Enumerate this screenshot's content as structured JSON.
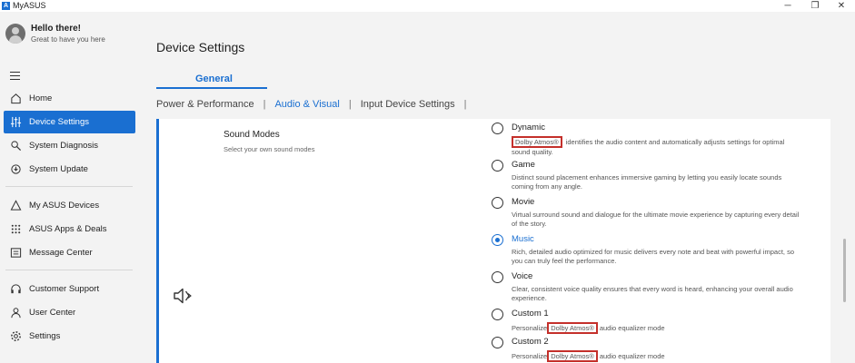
{
  "window": {
    "title": "MyASUS",
    "minimize": "─",
    "maximize": "❐",
    "close": "✕"
  },
  "user": {
    "greeting": "Hello there!",
    "subtitle": "Great to have you here"
  },
  "sidebar": {
    "items": [
      {
        "label": "Home",
        "icon": "home-icon"
      },
      {
        "label": "Device Settings",
        "icon": "sliders-icon",
        "active": true
      },
      {
        "label": "System Diagnosis",
        "icon": "diagnosis-icon"
      },
      {
        "label": "System Update",
        "icon": "update-icon"
      },
      {
        "label": "My ASUS Devices",
        "icon": "devices-icon"
      },
      {
        "label": "ASUS Apps & Deals",
        "icon": "apps-grid-icon"
      },
      {
        "label": "Message Center",
        "icon": "message-icon"
      },
      {
        "label": "Customer Support",
        "icon": "headset-icon"
      },
      {
        "label": "User Center",
        "icon": "user-icon"
      },
      {
        "label": "Settings",
        "icon": "gear-icon"
      }
    ]
  },
  "main": {
    "title": "Device Settings",
    "tab": "General",
    "subtabs": [
      "Power & Performance",
      "Audio & Visual",
      "Input Device Settings"
    ],
    "active_subtab": "Audio & Visual",
    "section": {
      "title": "Sound Modes",
      "description": "Select your own sound modes"
    },
    "modes": [
      {
        "name": "Dynamic",
        "badge": "Dolby Atmos®",
        "desc": " identifies the audio content and automatically adjusts settings for optimal sound quality."
      },
      {
        "name": "Game",
        "desc": "Distinct sound placement enhances immersive gaming by letting you easily locate sounds coming from any angle."
      },
      {
        "name": "Movie",
        "desc": "Virtual surround sound and dialogue for the ultimate movie experience by capturing every detail of the story."
      },
      {
        "name": "Music",
        "selected": true,
        "desc": "Rich, detailed audio optimized for music delivers every note and beat with powerful impact, so you can truly feel the performance."
      },
      {
        "name": "Voice",
        "desc": "Clear, consistent voice quality ensures that every word is heard, enhancing your overall audio experience."
      },
      {
        "name": "Custom 1",
        "prefix": "Personalize",
        "badge": "Dolby Atmos®",
        "desc": "audio equalizer mode"
      },
      {
        "name": "Custom 2",
        "prefix": "Personalize",
        "badge": "Dolby Atmos®",
        "desc": "audio equalizer mode"
      }
    ]
  },
  "colors": {
    "accent": "#1a6fd1",
    "highlight_box": "#c4302b"
  }
}
